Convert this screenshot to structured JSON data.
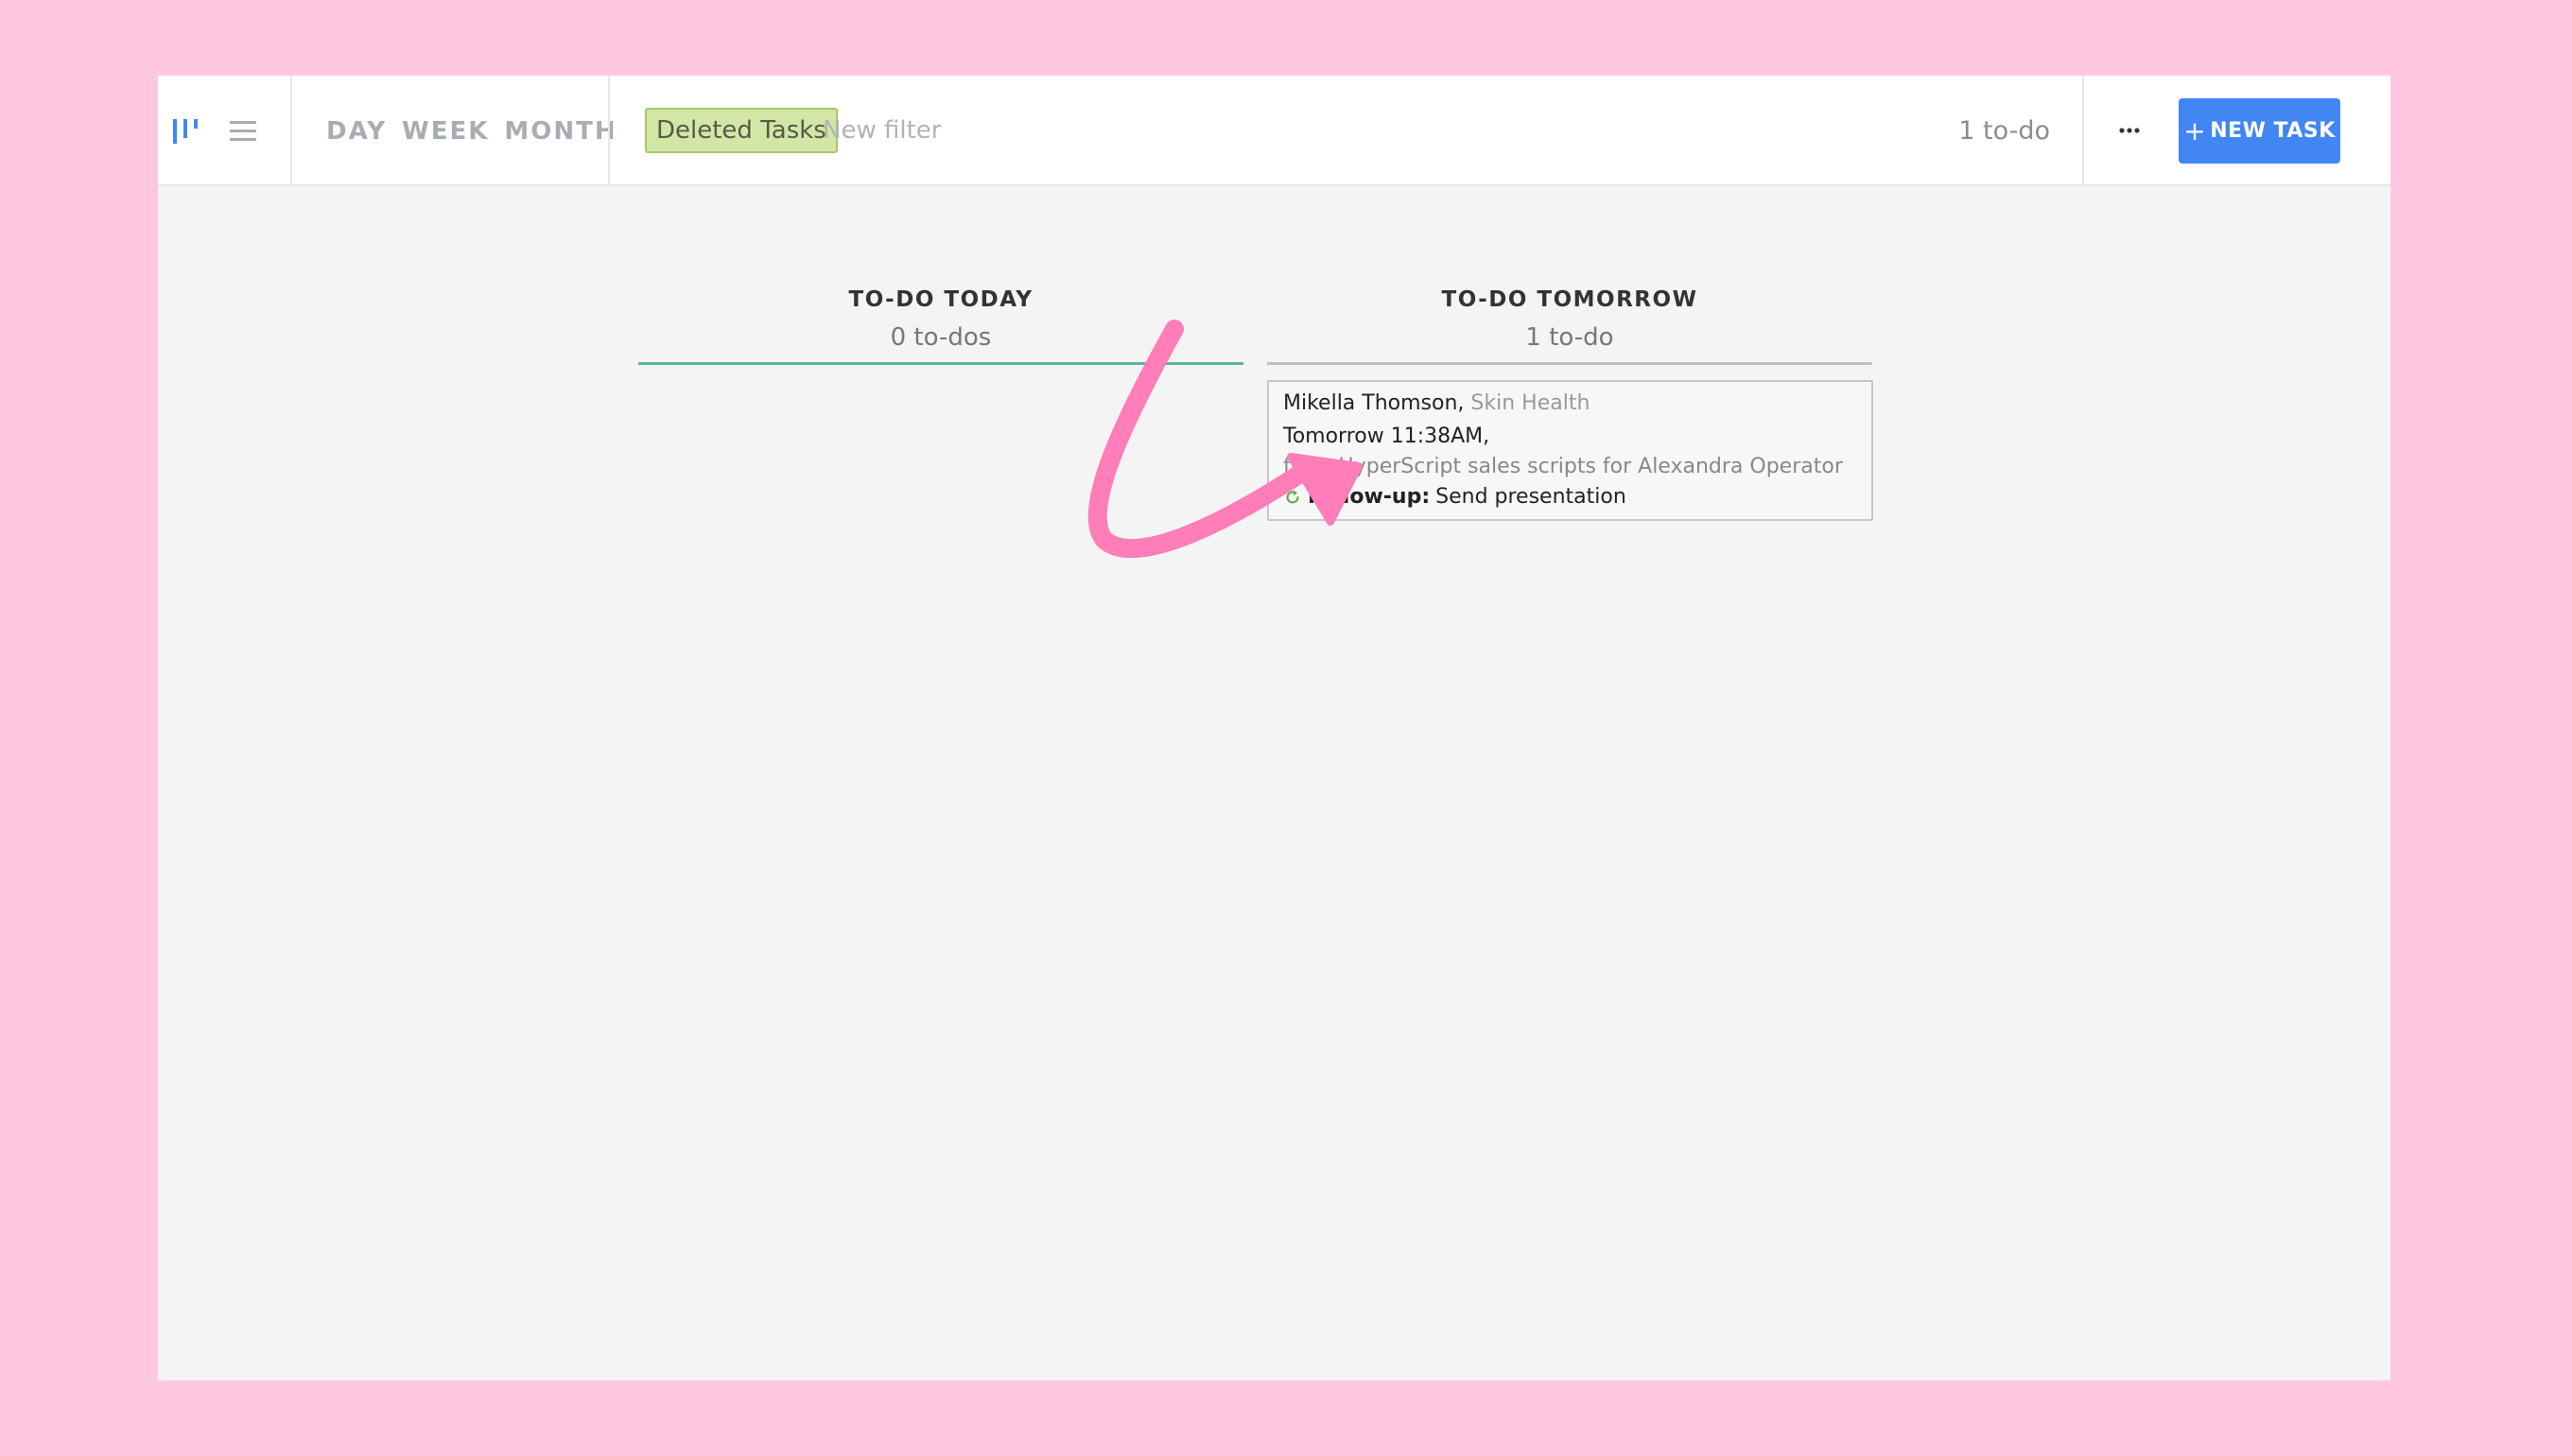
{
  "toolbar": {
    "view_toggles": [
      {
        "icon": "board-view-icon",
        "active": true,
        "color": "#4286f4"
      },
      {
        "icon": "list-view-icon",
        "active": false,
        "color": "#a8adb3"
      }
    ],
    "range_tabs": [
      "DAY",
      "WEEK",
      "MONTH"
    ],
    "active_filter": "Deleted Tasks",
    "new_filter_placeholder": "New filter",
    "todo_count": "1 to-do",
    "more_icon": "ellipsis-icon",
    "new_task_plus": "+",
    "new_task_label": "NEW TASK"
  },
  "columns": [
    {
      "title": "TO-DO TODAY",
      "count": "0 to-dos",
      "rule_color": "#5ab596",
      "tasks": []
    },
    {
      "title": "TO-DO TOMORROW",
      "count": "1 to-do",
      "rule_color": "#c0c0c0",
      "tasks": [
        {
          "contact": "Mikella Thomson,",
          "company": "Skin Health",
          "due": "Tomorrow 11:38AM,",
          "source": "from HyperScript sales scripts for Alexandra Operator",
          "icon": "follow-up-icon",
          "type": "Follow-up:",
          "title": "Send presentation"
        }
      ]
    }
  ],
  "annotation": {
    "icon": "pink-curved-arrow",
    "color": "#ff7eb9"
  },
  "colors": {
    "background": "#ffc8e0",
    "accent": "#4286f4",
    "filter_chip": "#d3e6a6",
    "follow_up_icon": "#6aa84f"
  }
}
